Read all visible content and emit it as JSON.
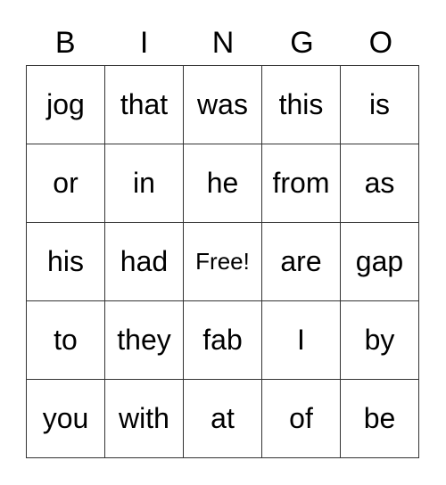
{
  "header": [
    "B",
    "I",
    "N",
    "G",
    "O"
  ],
  "grid": [
    [
      "jog",
      "that",
      "was",
      "this",
      "is"
    ],
    [
      "or",
      "in",
      "he",
      "from",
      "as"
    ],
    [
      "his",
      "had",
      "Free!",
      "are",
      "gap"
    ],
    [
      "to",
      "they",
      "fab",
      "I",
      "by"
    ],
    [
      "you",
      "with",
      "at",
      "of",
      "be"
    ]
  ]
}
